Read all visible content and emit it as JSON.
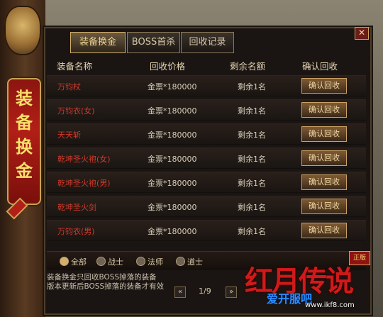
{
  "side": {
    "banner_title": "装\n备\n换\n金"
  },
  "tabs": [
    {
      "label": "装备换金"
    },
    {
      "label": "BOSS首杀"
    },
    {
      "label": "回收记录"
    }
  ],
  "table": {
    "headers": [
      "装备名称",
      "回收价格",
      "剩余名额",
      "确认回收"
    ],
    "rows": [
      {
        "name": "万钧杖",
        "price": "金票*180000",
        "remaining": "剩余1名",
        "action": "确认回收"
      },
      {
        "name": "万钧衣(女)",
        "price": "金票*180000",
        "remaining": "剩余1名",
        "action": "确认回收"
      },
      {
        "name": "天天斩",
        "price": "金票*180000",
        "remaining": "剩余1名",
        "action": "确认回收"
      },
      {
        "name": "乾坤圣火袍(女)",
        "price": "金票*180000",
        "remaining": "剩余1名",
        "action": "确认回收"
      },
      {
        "name": "乾坤圣火袍(男)",
        "price": "金票*180000",
        "remaining": "剩余1名",
        "action": "确认回收"
      },
      {
        "name": "乾坤圣火剑",
        "price": "金票*180000",
        "remaining": "剩余1名",
        "action": "确认回收"
      },
      {
        "name": "万钧衣(男)",
        "price": "金票*180000",
        "remaining": "剩余1名",
        "action": "确认回收"
      }
    ]
  },
  "filters": [
    {
      "label": "全部",
      "selected": true
    },
    {
      "label": "战士",
      "selected": false
    },
    {
      "label": "法师",
      "selected": false
    },
    {
      "label": "道士",
      "selected": false
    }
  ],
  "notes": {
    "line1": "装备换金只回收BOSS掉落的装备",
    "line2": "版本更新后BOSS掉落的装备才有效"
  },
  "pager": {
    "prev": "«",
    "page": "1/9",
    "next": "»"
  },
  "branding": {
    "logo_text": "红月传说",
    "stamp": "正版",
    "site_title": "爱开服吧",
    "site_url": "www.ikf8.com"
  }
}
